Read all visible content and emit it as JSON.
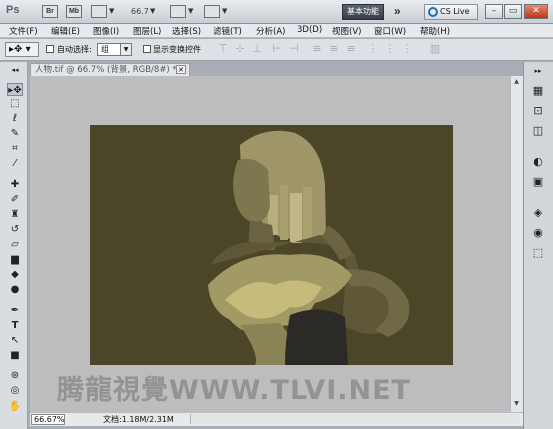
{
  "app": {
    "logo": "Ps",
    "bridge_label": "Br",
    "mini_bridge_label": "Mb",
    "zoom": "66.7",
    "workspace": "基本功能",
    "overflow": "»",
    "cslive": "CS Live",
    "window_controls": [
      "minimize",
      "restore",
      "close"
    ]
  },
  "menu": [
    "文件(F)",
    "编辑(E)",
    "图像(I)",
    "图层(L)",
    "选择(S)",
    "滤镜(T)",
    "分析(A)",
    "3D(D)",
    "视图(V)",
    "窗口(W)",
    "帮助(H)"
  ],
  "options": {
    "auto_select_label": "自动选择:",
    "auto_select_value": "组",
    "show_transform_label": "显示变换控件"
  },
  "document": {
    "tab_title": "人物.tif @ 66.7% (背景, RGB/8#) *",
    "zoom_status": "66.67%",
    "doc_info": "文档:1.18M/2.31M"
  },
  "watermark": "腾龍視覺WWW.TLVI.NET",
  "colors": {
    "canvas_bg": "#4c4628",
    "pasteboard": "#bdbdbd",
    "workspace_btn": "#3a424c"
  },
  "icons": {
    "left_tools": [
      "move-icon",
      "marquee-icon",
      "lasso-icon",
      "quick-select-icon",
      "crop-icon",
      "eyedropper-icon",
      "healing-icon",
      "brush-icon",
      "stamp-icon",
      "history-brush-icon",
      "eraser-icon",
      "gradient-icon",
      "blur-icon",
      "dodge-icon",
      "pen-icon",
      "type-icon",
      "path-select-icon",
      "shape-icon",
      "3d-rotate-icon",
      "3d-orbit-icon",
      "hand-icon"
    ],
    "right_panels": [
      "histogram-icon",
      "info-icon",
      "navigator-icon",
      "adjustments-icon",
      "masks-icon",
      "layers-icon",
      "channels-icon",
      "paths-icon"
    ]
  }
}
